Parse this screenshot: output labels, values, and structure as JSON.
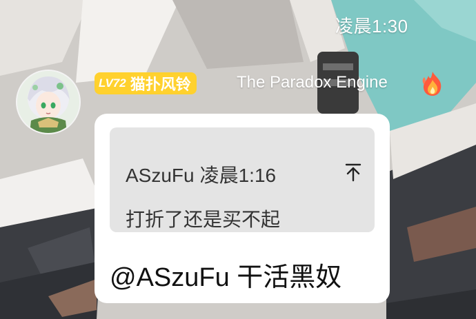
{
  "header": {
    "timestamp": "凌晨1:30"
  },
  "sender": {
    "level": "LV72",
    "nickname": "猫扑风铃",
    "title": "The Paradox Engine",
    "title_icon": "flame-icon",
    "avatar": "anime-girl-avatar"
  },
  "message": {
    "quote": {
      "author": "ASzuFu",
      "time": "凌晨1:16",
      "text": "打折了还是买不起",
      "jump_icon": "jump-to-top-icon"
    },
    "text": "@ASzuFu 干活黑奴"
  },
  "colors": {
    "level_badge": "#ffd12e",
    "bubble": "#ffffff",
    "quote_background": "#e4e4e4",
    "background_teal": "#7fc8c4"
  }
}
